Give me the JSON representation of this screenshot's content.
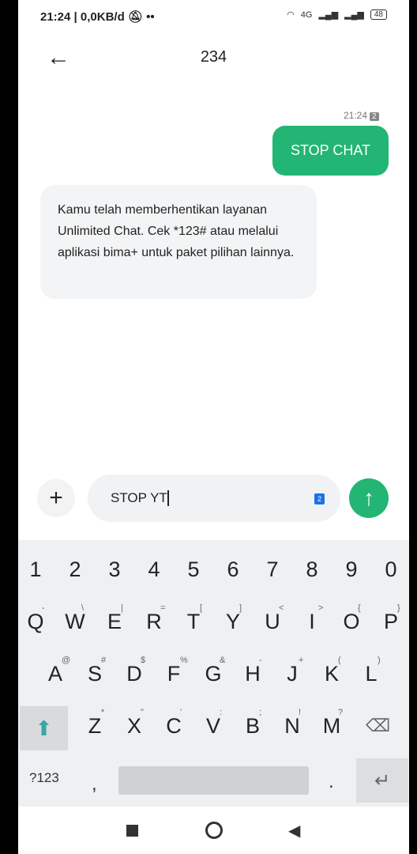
{
  "status_bar": {
    "left": "21:24 | 0,0KB/d",
    "icons": [
      "bell-off-icon",
      "keyboard-icon",
      "more-dots-icon"
    ],
    "network": "4G",
    "battery": "48"
  },
  "header": {
    "title": "234",
    "back_icon": "arrow-left-icon"
  },
  "messages": [
    {
      "direction": "outgoing",
      "time": "21:24",
      "sim": "2",
      "text": "STOP CHAT"
    },
    {
      "direction": "incoming",
      "text": "Kamu telah memberhentikan layanan Unlimited Chat. Cek *123# atau melalui aplikasi bima+ untuk paket pilihan lainnya."
    }
  ],
  "composer": {
    "value": "STOP YT",
    "sim": "2",
    "accent": "#22b573"
  },
  "keyboard": {
    "numbers": [
      "1",
      "2",
      "3",
      "4",
      "5",
      "6",
      "7",
      "8",
      "9",
      "0"
    ],
    "row1": [
      "Q",
      "W",
      "E",
      "R",
      "T",
      "Y",
      "U",
      "I",
      "O",
      "P"
    ],
    "row1_hints": [
      "-",
      "\\",
      "|",
      "=",
      "[",
      "]",
      "<",
      ">",
      "{",
      "}"
    ],
    "row2": [
      "A",
      "S",
      "D",
      "F",
      "G",
      "H",
      "J",
      "K",
      "L"
    ],
    "row2_hints": [
      "@",
      "#",
      "$",
      "%",
      "&",
      "-",
      "+",
      "(",
      ")"
    ],
    "row3": [
      "Z",
      "X",
      "C",
      "V",
      "B",
      "N",
      "M"
    ],
    "row3_hints": [
      "*",
      "\"",
      "'",
      ":",
      ";",
      "!",
      "?"
    ],
    "symbols_key": "?123",
    "comma": ",",
    "period": "."
  }
}
